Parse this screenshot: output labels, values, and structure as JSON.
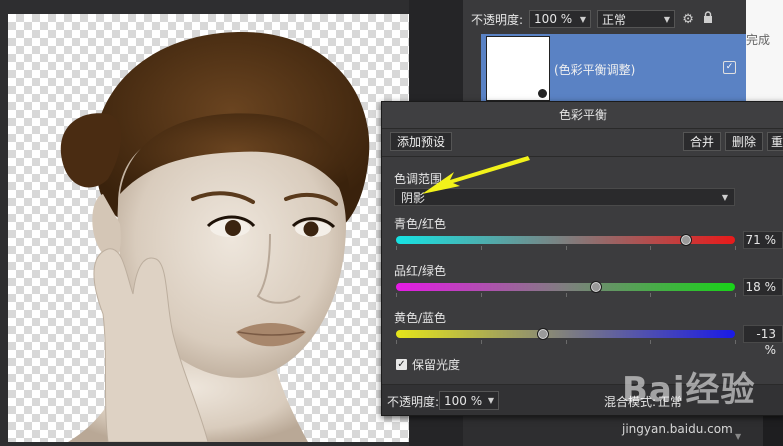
{
  "layers_panel": {
    "opacity_label": "不透明度:",
    "opacity_value": "100 %",
    "blend_mode": "正常",
    "layer_name": "(色彩平衡调整)",
    "layer_visible_check": "✓"
  },
  "right_panel": {
    "partial_text": "完成"
  },
  "color_balance": {
    "title": "色彩平衡",
    "toolbar": {
      "add_preset": "添加预设",
      "merge": "合并",
      "delete": "删除",
      "reset_partial": "重"
    },
    "tone_range_label": "色调范围",
    "tone_range_value": "阴影",
    "sliders": [
      {
        "label": "青色/红色",
        "value_text": "71 %",
        "value": 71,
        "colors": [
          "#16e3e3",
          "#e81a1a"
        ]
      },
      {
        "label": "品红/绿色",
        "value_text": "18 %",
        "value": 18,
        "colors": [
          "#e61ae6",
          "#18d418"
        ]
      },
      {
        "label": "黄色/蓝色",
        "value_text": "-13 %",
        "value": -13,
        "colors": [
          "#e6e61a",
          "#1a1ae6"
        ]
      }
    ],
    "preserve_luminosity": "保留光度",
    "preserve_check": "✓",
    "footer": {
      "opacity_label": "不透明度:",
      "opacity_value": "100 %",
      "blend_label": "混合模式:",
      "blend_value": "正常"
    }
  },
  "annotation": {
    "arrow_color": "#f2f21a"
  },
  "watermark": {
    "text": "Bai经验",
    "url": "jingyan.baidu.com"
  }
}
